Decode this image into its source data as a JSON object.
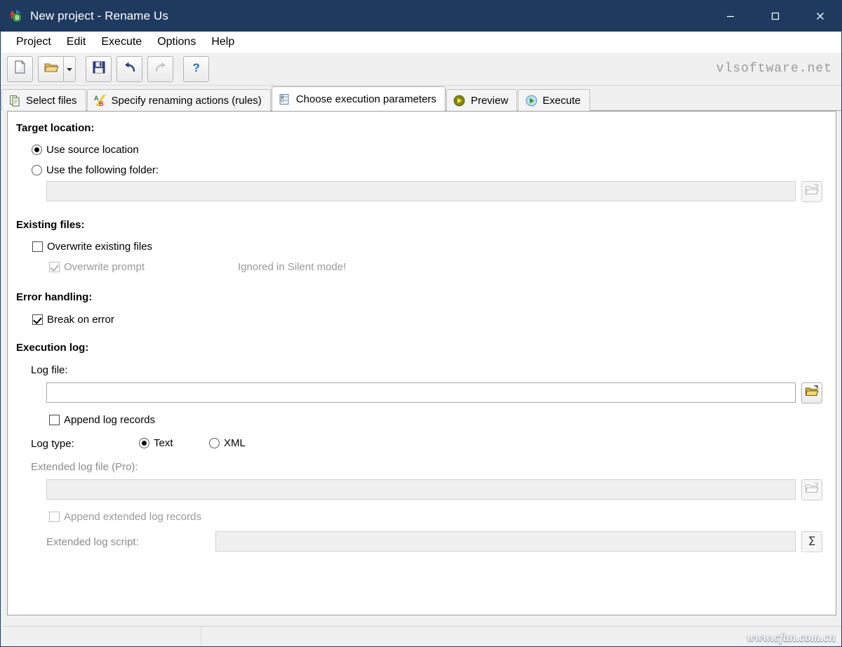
{
  "window": {
    "title": "New project - Rename Us",
    "icon": "renameus-app-icon",
    "accent_titlebar": "#1e3a5f",
    "controls": {
      "minimize": "minimize-icon",
      "maximize": "maximize-icon",
      "close": "close-icon"
    }
  },
  "menubar": {
    "items": [
      {
        "label": "Project"
      },
      {
        "label": "Edit"
      },
      {
        "label": "Execute"
      },
      {
        "label": "Options"
      },
      {
        "label": "Help"
      }
    ]
  },
  "toolbar": {
    "buttons": [
      {
        "icon": "new-document-icon",
        "enabled": true
      },
      {
        "icon": "open-folder-icon",
        "enabled": true
      },
      {
        "icon": "dropdown-arrow-icon",
        "enabled": true
      },
      {
        "icon": "save-floppy-icon",
        "enabled": true
      },
      {
        "icon": "undo-icon",
        "enabled": true
      },
      {
        "icon": "redo-icon",
        "enabled": false
      },
      {
        "icon": "help-question-icon",
        "enabled": true
      }
    ],
    "brand": "vlsoftware.net"
  },
  "tabs": [
    {
      "label": "Select files",
      "icon": "copy-files-icon",
      "active": false
    },
    {
      "label": "Specify renaming actions (rules)",
      "icon": "ab-rename-icon",
      "active": false
    },
    {
      "label": "Choose execution parameters",
      "icon": "checklist-icon",
      "active": true
    },
    {
      "label": "Preview",
      "icon": "play-yellow-icon",
      "active": false
    },
    {
      "label": "Execute",
      "icon": "play-blue-icon",
      "active": false
    }
  ],
  "form": {
    "target_location": {
      "heading": "Target location:",
      "option_source": "Use source location",
      "option_folder": "Use the following folder:",
      "selected": "source",
      "folder_value": "",
      "folder_enabled": false,
      "browse_icon": "folder-browse-icon"
    },
    "existing_files": {
      "heading": "Existing files:",
      "overwrite_label": "Overwrite existing files",
      "overwrite_checked": false,
      "prompt_label": "Overwrite prompt",
      "prompt_checked": true,
      "prompt_enabled": false,
      "silent_note": "Ignored in Silent mode!"
    },
    "error_handling": {
      "heading": "Error handling:",
      "break_label": "Break on error",
      "break_checked": true
    },
    "execution_log": {
      "heading": "Execution log:",
      "log_file_label": "Log file:",
      "log_file_value": "",
      "log_file_browse_icon": "folder-browse-icon",
      "append_label": "Append log records",
      "append_checked": false,
      "log_type_label": "Log type:",
      "log_type_options": [
        {
          "label": "Text",
          "selected": true
        },
        {
          "label": "XML",
          "selected": false
        }
      ],
      "ext_log_file_label": "Extended log file (Pro):",
      "ext_log_file_value": "",
      "ext_log_file_enabled": false,
      "ext_log_browse_icon": "folder-browse-icon",
      "append_ext_label": "Append extended log records",
      "append_ext_checked": false,
      "append_ext_enabled": false,
      "ext_script_label": "Extended log script:",
      "ext_script_value": "",
      "ext_script_enabled": false,
      "ext_script_button_icon": "sigma-icon",
      "ext_script_button_glyph": "Σ"
    }
  },
  "statusbar": {
    "cells": [
      "",
      ""
    ]
  },
  "watermark": "www.cfan.com.cn"
}
